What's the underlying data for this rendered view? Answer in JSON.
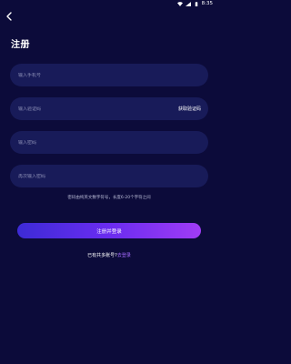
{
  "status_bar": {
    "time": "8:35",
    "icons": [
      "wifi-icon",
      "signal-icon",
      "battery-icon"
    ]
  },
  "header": {
    "back_icon": "chevron-left-icon",
    "title": "注册"
  },
  "form": {
    "phone": {
      "placeholder": "输入手机号"
    },
    "code": {
      "placeholder": "输入验证码",
      "get_code_label": "获取验证码"
    },
    "password": {
      "placeholder": "输入密码"
    },
    "password_confirm": {
      "placeholder": "再次输入密码"
    },
    "hint": "密码由纯英文数字符号，长度6-20个字符之间"
  },
  "submit_label": "注册并登录",
  "login_prompt": {
    "text": "已有共多账号?",
    "action": "去登录"
  },
  "colors": {
    "background": "#0c0b3a",
    "field": "#181b59",
    "accent": "#a66cff",
    "gradient_start": "#3d2bd6",
    "gradient_end": "#a03cf5"
  }
}
